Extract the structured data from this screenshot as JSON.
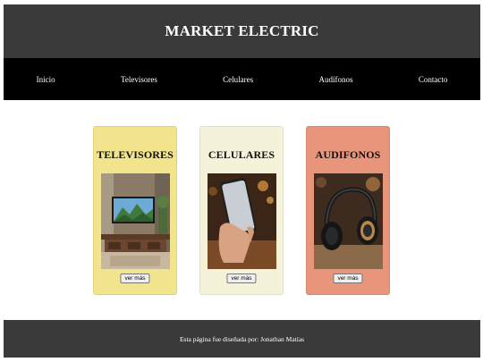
{
  "header": {
    "title": "MARKET ELECTRIC"
  },
  "nav": {
    "items": [
      {
        "label": "Inicio"
      },
      {
        "label": "Televisores"
      },
      {
        "label": "Celulares"
      },
      {
        "label": "Audífonos"
      },
      {
        "label": "Contacto"
      }
    ]
  },
  "cards": [
    {
      "title": "TELEVISORES",
      "button_label": "ver más",
      "color": "#f1e48c"
    },
    {
      "title": "CELULARES",
      "button_label": "ver más",
      "color": "#f4f2d9"
    },
    {
      "title": "AUDIFONOS",
      "button_label": "ver más",
      "color": "#e8957b"
    }
  ],
  "footer": {
    "text": "Esta página fue diseñada por: Jonathan Matías"
  }
}
